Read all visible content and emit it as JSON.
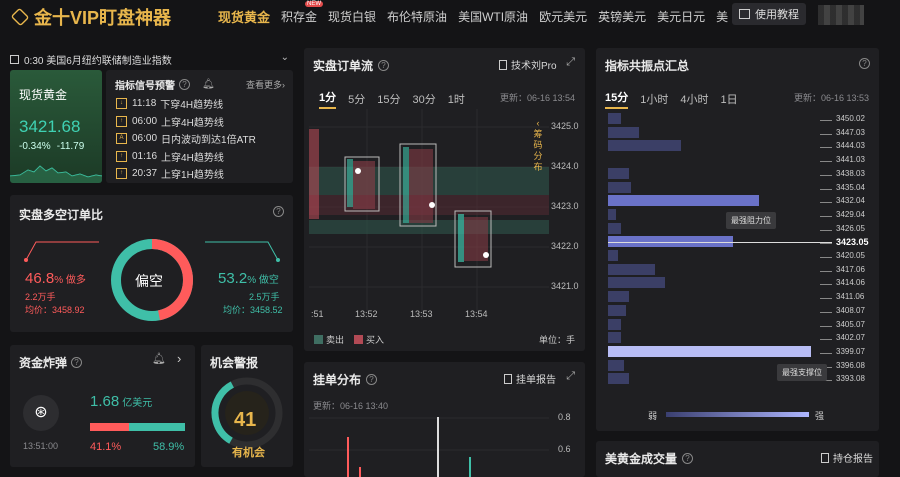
{
  "app": {
    "logo_text": "金十VIP盯盘神器"
  },
  "nav": {
    "items": [
      "现货黄金",
      "积存金",
      "现货白银",
      "布伦特原油",
      "美国WTI原油",
      "欧元美元",
      "英镑美元",
      "美元日元",
      "美"
    ],
    "new_badge": "NEW",
    "tutorial_label": "使用教程"
  },
  "calendar": {
    "text": "0:30 美国6月纽约联储制造业指数"
  },
  "quote": {
    "name": "现货黄金",
    "price": "3421.68",
    "change_pct": "-0.34%",
    "change": "-11.79"
  },
  "signals": {
    "title": "指标信号预警",
    "more": "查看更多",
    "items": [
      {
        "time": "11:18",
        "text": "下穿4H趋势线"
      },
      {
        "time": "06:00",
        "text": "上穿4H趋势线"
      },
      {
        "time": "06:00",
        "text": "日内波动到达1倍ATR"
      },
      {
        "time": "01:16",
        "text": "上穿4H趋势线"
      },
      {
        "time": "20:37",
        "text": "上穿1H趋势线"
      }
    ]
  },
  "longshort": {
    "title": "实盘多空订单比",
    "center": "偏空",
    "long_pct": "46.8",
    "long_pct_unit": "% 做多",
    "long_hands": "2.2万手",
    "long_avg": "均价：3458.92",
    "short_pct": "53.2",
    "short_pct_unit": "% 做空",
    "short_hands": "2.5万手",
    "short_avg": "均价：3458.52",
    "long_share": 0.468
  },
  "orderflow": {
    "title": "实盘订单流",
    "btn": "技术刘Pro",
    "tabs": [
      "1分",
      "5分",
      "15分",
      "30分",
      "1时"
    ],
    "updated": "更新：06-16 13:54",
    "side_label": "筹码分布",
    "y_ticks": [
      "3425.0",
      "3424.0",
      "3423.0",
      "3422.0",
      "3421.0"
    ],
    "x_ticks": [
      ":51",
      "13:52",
      "13:53",
      "13:54"
    ],
    "legend_sell": "卖出",
    "legend_buy": "买入",
    "unit": "单位：手"
  },
  "pivot": {
    "title": "指标共振点汇总",
    "tabs": [
      "15分",
      "1小时",
      "4小时",
      "1日"
    ],
    "updated": "更新：06-16 13:53",
    "levels": [
      "3450.02",
      "3447.03",
      "3444.03",
      "3441.03",
      "3438.03",
      "3435.04",
      "3432.04",
      "3429.04",
      "3426.05",
      "3423.05",
      "3420.05",
      "3417.06",
      "3414.06",
      "3411.06",
      "3408.07",
      "3405.07",
      "3402.07",
      "3399.07",
      "3396.08",
      "3393.08"
    ],
    "strengths": [
      0.05,
      0.12,
      0.28,
      0,
      0.08,
      0.09,
      0.58,
      0.03,
      0.05,
      0.48,
      0.04,
      0.18,
      0.22,
      0.08,
      0.07,
      0.05,
      0.05,
      0.78,
      0.06,
      0.08
    ],
    "resist_label": "最强阻力位",
    "support_label": "最强支撑位",
    "weak": "弱",
    "strong": "强",
    "current": "3423.05"
  },
  "bomb": {
    "title": "资金炸弹",
    "time": "13:51:00",
    "amount": "1.68",
    "amount_unit": "亿美元",
    "red_pct": "41.1%",
    "green_pct": "58.9%",
    "red_share": 0.411
  },
  "alert": {
    "title": "机会警报",
    "value": "41",
    "label": "有机会",
    "level": 0.41
  },
  "pending": {
    "title": "挂单分布",
    "btn": "挂单报告",
    "updated": "更新：06-16 13:40",
    "y_ticks": [
      "0.8",
      "0.6"
    ]
  },
  "volume": {
    "title": "美黄金成交量",
    "btn": "持仓报告"
  },
  "colors": {
    "accent": "#e8b64c",
    "green": "#3fbfa8",
    "red": "#ff5b5b",
    "bar": "#6a72c8"
  }
}
